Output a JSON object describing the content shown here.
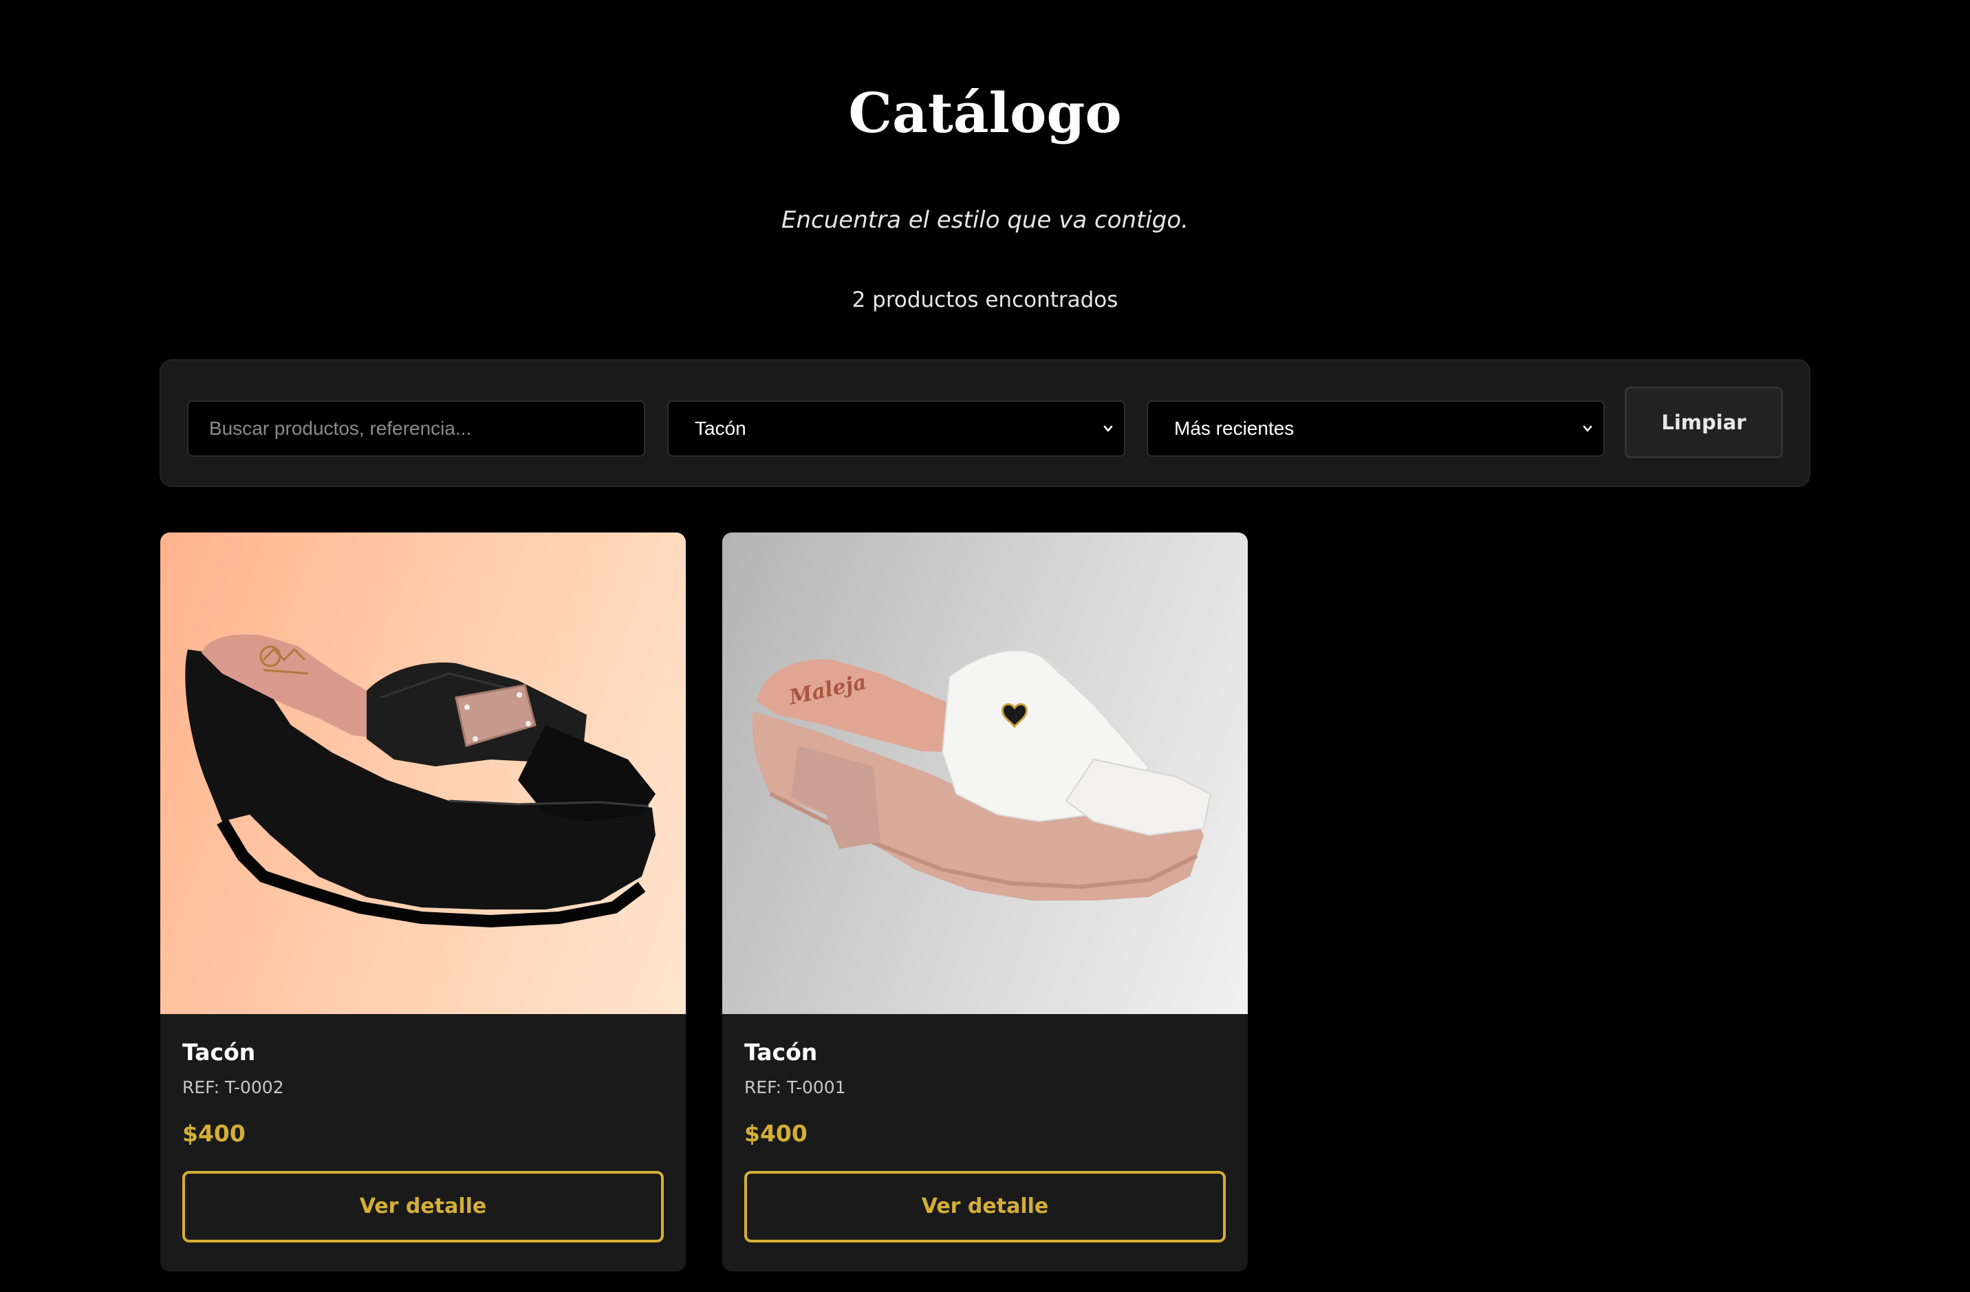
{
  "header": {
    "title": "Catálogo",
    "subtitle": "Encuentra el estilo que va contigo.",
    "results_count": "2 productos encontrados"
  },
  "filters": {
    "search_placeholder": "Buscar productos, referencia...",
    "category_selected": "Tacón",
    "sort_selected": "Más recientes",
    "clear_label": "Limpiar"
  },
  "products": [
    {
      "name": "Tacón",
      "ref": "REF: T-0002",
      "price": "$400",
      "button_label": "Ver detalle",
      "image": "black-platform-heel-sandal"
    },
    {
      "name": "Tacón",
      "ref": "REF: T-0001",
      "price": "$400",
      "button_label": "Ver detalle",
      "image": "white-platform-heel-sandal",
      "insole_brand": "Maleja"
    }
  ],
  "colors": {
    "background": "#000000",
    "panel": "#1a1a1a",
    "accent_gold": "#d4af37"
  }
}
